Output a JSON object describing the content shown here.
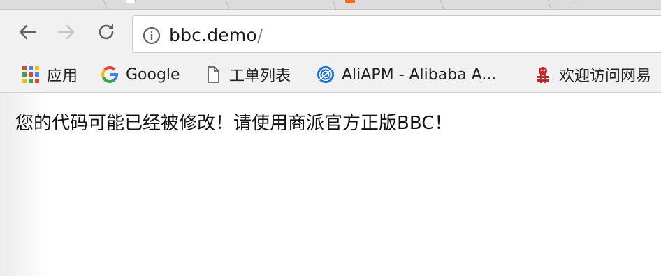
{
  "browser": {
    "address_bar": {
      "host": "bbc.demo",
      "path": "/"
    },
    "bookmarks": [
      {
        "label": "应用",
        "icon": "apps-grid-icon"
      },
      {
        "label": "Google",
        "icon": "google-g-icon"
      },
      {
        "label": "工单列表",
        "icon": "document-icon"
      },
      {
        "label": "AliAPM - Alibaba A...",
        "icon": "aliapm-icon"
      },
      {
        "label": "欢迎访问网易",
        "icon": "netease-icon"
      }
    ]
  },
  "page": {
    "message": "您的代码可能已经被修改！请使用商派官方正版BBC！"
  },
  "colors": {
    "toolbar": "#f1f1f1",
    "tabstrip": "#dcdcdc",
    "google_blue": "#4285f4",
    "google_red": "#ea4335",
    "google_yellow": "#fbbc05",
    "google_green": "#34a853",
    "aliapm_blue": "#1e6fd8",
    "netease_red": "#d0202a"
  }
}
